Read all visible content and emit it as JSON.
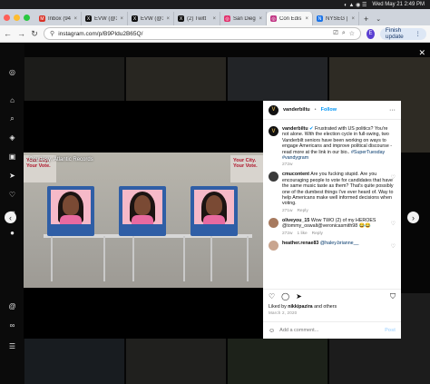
{
  "menubar": {
    "datetime": "Wed May 21  2:49 PM"
  },
  "tabs": [
    {
      "label": "Inbox (94",
      "favicon_color": "#d93025",
      "active": false
    },
    {
      "label": "EVW (@1",
      "favicon_color": "#111111",
      "active": false
    },
    {
      "label": "EVW (@1",
      "favicon_color": "#111111",
      "active": false
    },
    {
      "label": "(2) Twitt",
      "favicon_color": "#111111",
      "active": false
    },
    {
      "label": "San Dieg",
      "favicon_color": "#e1306c",
      "active": false
    },
    {
      "label": "Con Edis",
      "favicon_color": "#c13584",
      "active": true
    },
    {
      "label": "NYSEG |",
      "favicon_color": "#1a73e8",
      "active": false
    }
  ],
  "toolbar": {
    "url": "instagram.com/p/B9PIdu2B65Q/",
    "profile_initial": "E",
    "finish_update_label": "Finish update"
  },
  "post": {
    "author": "vanderbiltu",
    "author_initial": "V",
    "follow_label": "Follow",
    "photo_credit": "Courtesy: Atlantic Records",
    "poster_text": "Your City. Your Vote.",
    "caption": {
      "text": "Frustrated with US politics? You're not alone. With the election cycle in full-swing, two Vanderbilt seniors have been working on ways to engage Americans and improve political discourse - read more at the link in our bio..",
      "tags": "#SuperTuesday #vandygram",
      "age": "272w"
    },
    "comments": [
      {
        "user": "cmucontent",
        "text": "Are you fucking stupid. Are you encouraging people to vote for candidates that have the same music taste as them? That's quite possibly one of the dumbest things I've ever heard of. Way to help Americans make well informed decisions when voting.",
        "age": "271w",
        "reply": "Reply",
        "likes": "",
        "avatar_color": "#3a3a3a"
      },
      {
        "user": "oliveyou_15",
        "text": "Wow TWO (2) of my HEROES @tommy_oswalt@veronicasmith98 😂😂",
        "age": "272w",
        "likes": "1 like",
        "reply": "Reply",
        "avatar_color": "#a77a5f"
      },
      {
        "user": "heather.renae83",
        "text": "@haley.brianne__",
        "age": "",
        "likes": "",
        "reply": "",
        "avatar_color": "#c9a58f"
      }
    ],
    "liked_by_prefix": "Liked by",
    "liked_by_user": "nikkipazira",
    "liked_by_suffix": "and others",
    "date": "March 2, 2020",
    "add_comment_placeholder": "Add a comment...",
    "post_label": "Post"
  },
  "colors": {
    "follow_blue": "#0095f6",
    "booth_blue": "#2f5ea6",
    "screen_pink": "#f6b9c8"
  },
  "icons": {
    "sidebar": [
      "instagram-icon",
      "home-icon",
      "search-icon",
      "explore-icon",
      "reels-icon",
      "messages-icon",
      "notifications-icon",
      "create-icon",
      "profile-icon",
      "threads-icon",
      "meta-icon",
      "menu-icon"
    ],
    "actions": [
      "heart-icon",
      "comment-icon",
      "share-icon",
      "bookmark-icon"
    ]
  }
}
